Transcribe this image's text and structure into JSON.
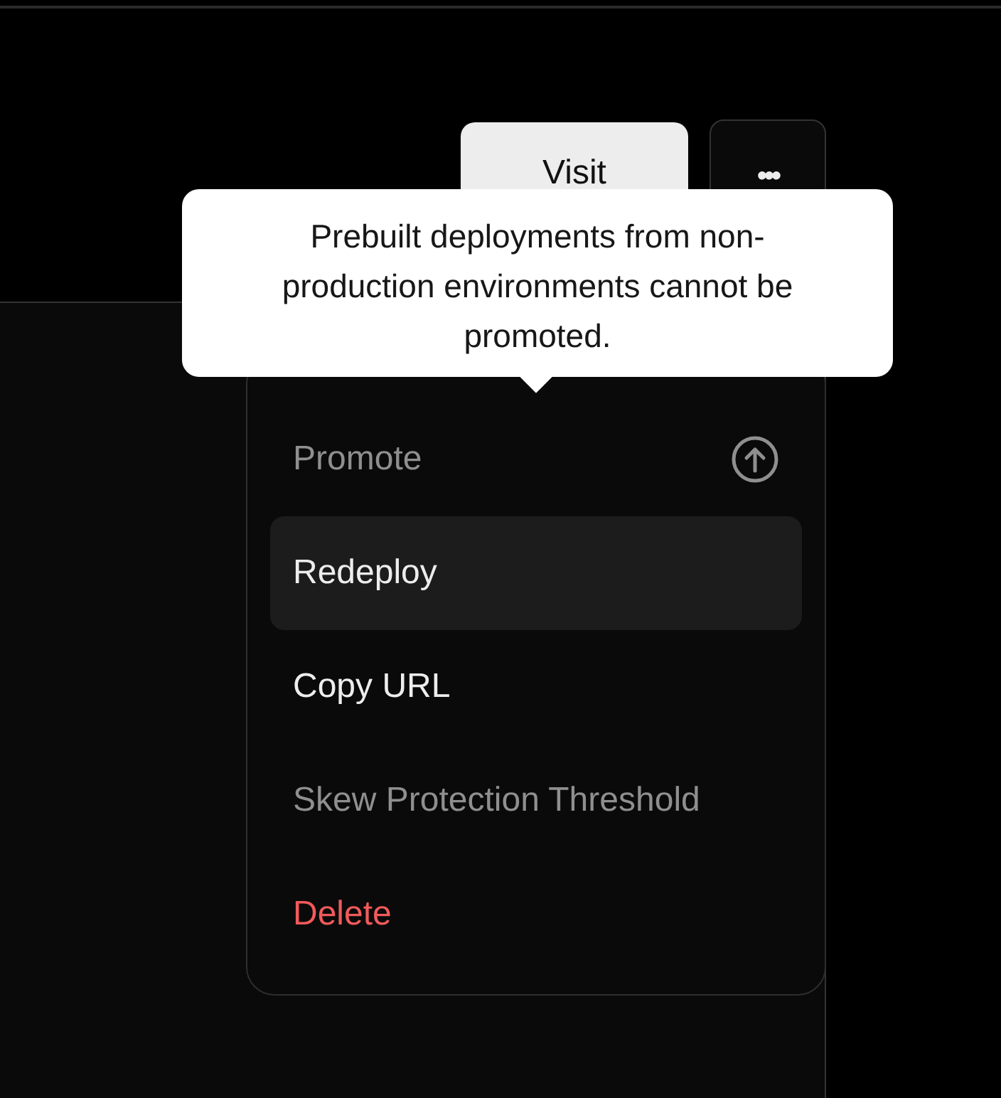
{
  "header": {
    "buttons": [
      {
        "kind": "primary",
        "label": "Visit"
      },
      {
        "kind": "more",
        "label": "•••"
      }
    ]
  },
  "tooltip": {
    "text": "Prebuilt deployments from non-production environments cannot be promoted."
  },
  "menu": {
    "items": [
      {
        "label": "Promote",
        "kind": "promote",
        "disabled": true,
        "selected": false
      },
      {
        "label": "Redeploy",
        "kind": "plain",
        "disabled": false,
        "selected": true
      },
      {
        "label": "Copy URL",
        "kind": "plain",
        "disabled": false,
        "selected": false
      },
      {
        "label": "Skew Protection Threshold",
        "kind": "plain",
        "disabled": true,
        "selected": false
      },
      {
        "label": "Delete",
        "kind": "danger",
        "disabled": false,
        "selected": false
      }
    ]
  }
}
